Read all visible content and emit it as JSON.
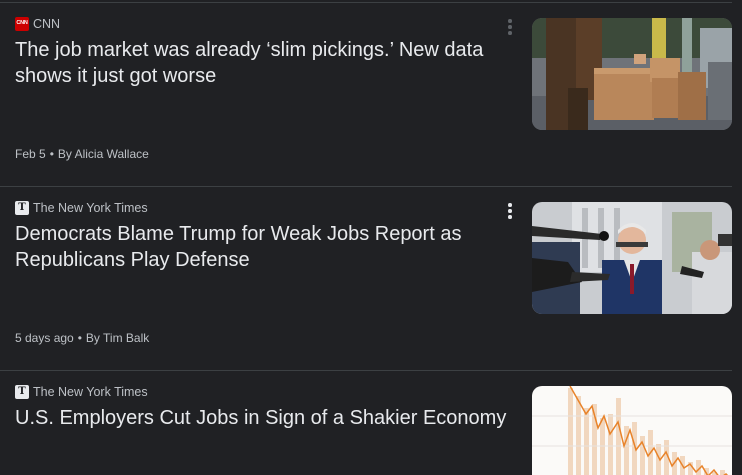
{
  "articles": [
    {
      "source": "CNN",
      "logo_icon": "cnn-logo-icon",
      "headline": "The job market was already ‘slim pickings.’ New data shows it just got worse",
      "date": "Feb 5",
      "author": "By Alicia Wallace",
      "thumbnail": "delivery-worker-with-boxes-image"
    },
    {
      "source": "The New York Times",
      "logo_icon": "nyt-logo-icon",
      "headline": "Democrats Blame Trump for Weak Jobs Report as Republicans Play Defense",
      "date": "5 days ago",
      "author": "By Tim Balk",
      "thumbnail": "politician-press-scrum-image"
    },
    {
      "source": "The New York Times",
      "logo_icon": "nyt-logo-icon",
      "headline": "U.S. Employers Cut Jobs in Sign of a Shakier Economy",
      "thumbnail": "jobs-chart-image"
    }
  ],
  "separator": "•",
  "colors": {
    "background": "#202124",
    "headline": "#e8eaed",
    "meta": "#bdc1c6",
    "divider": "#3c4043",
    "cnn_red": "#cc0000",
    "chart_orange": "#e8832a"
  }
}
